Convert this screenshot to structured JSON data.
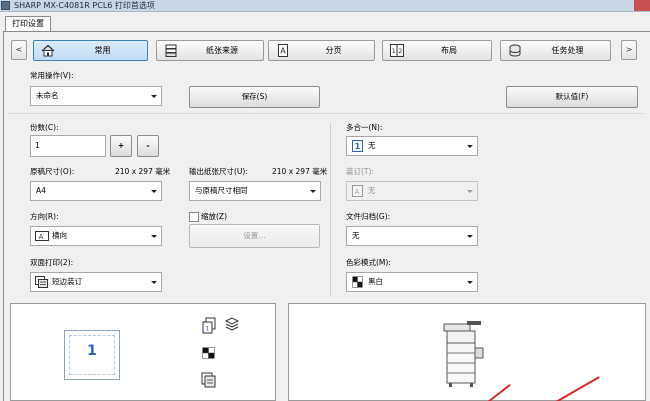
{
  "window": {
    "title": "SHARP MX-C4081R PCL6 打印首选项"
  },
  "tabs": [
    {
      "label": "打印设置"
    }
  ],
  "nav": {
    "prev_label": "<",
    "next_label": ">",
    "items": [
      {
        "label": "常用",
        "icon": "home-icon",
        "active": true
      },
      {
        "label": "纸张来源",
        "icon": "paper-tray-icon",
        "active": false
      },
      {
        "label": "分页",
        "icon": "page-icon",
        "active": false
      },
      {
        "label": "布局",
        "icon": "layout-icon",
        "active": false
      },
      {
        "label": "任务处理",
        "icon": "job-handling-icon",
        "active": false
      }
    ]
  },
  "favorites": {
    "label": "常用操作(V):",
    "value": "未命名",
    "save_label": "保存(S)",
    "default_label": "默认值(F)"
  },
  "copies": {
    "label": "份数(C):",
    "value": "1",
    "plus_label": "+",
    "minus_label": "-"
  },
  "original_size": {
    "label": "原稿尺寸(O):",
    "dimensions": "210 x 297 毫米",
    "value": "A4"
  },
  "output_size": {
    "label": "输出纸张尺寸(U):",
    "dimensions": "210 x 297 毫米",
    "value": "与原稿尺寸相同"
  },
  "orientation": {
    "label": "方向(R):",
    "value": "横向",
    "icon": "landscape-icon"
  },
  "zoom": {
    "label": "缩放(Z)",
    "checked": false,
    "settings_label": "设置..."
  },
  "duplex": {
    "label": "双面打印(2):",
    "value": "短边装订",
    "icon": "duplex-icon"
  },
  "n_up": {
    "label": "多合一(N):",
    "value": "无",
    "icon": "n-up-icon"
  },
  "binding": {
    "label": "装订(T):",
    "value": "无",
    "icon": "staple-icon",
    "disabled": true
  },
  "retention": {
    "label": "文件归档(G):",
    "value": "无"
  },
  "color_mode": {
    "label": "色彩模式(M):",
    "value": "黑白",
    "icon": "color-mode-icon"
  },
  "preview": {
    "page_number": "1"
  },
  "colors": {
    "accent_border": "#3c7fb1",
    "arrow": "#d42a2a",
    "page_number": "#2a62b4"
  }
}
